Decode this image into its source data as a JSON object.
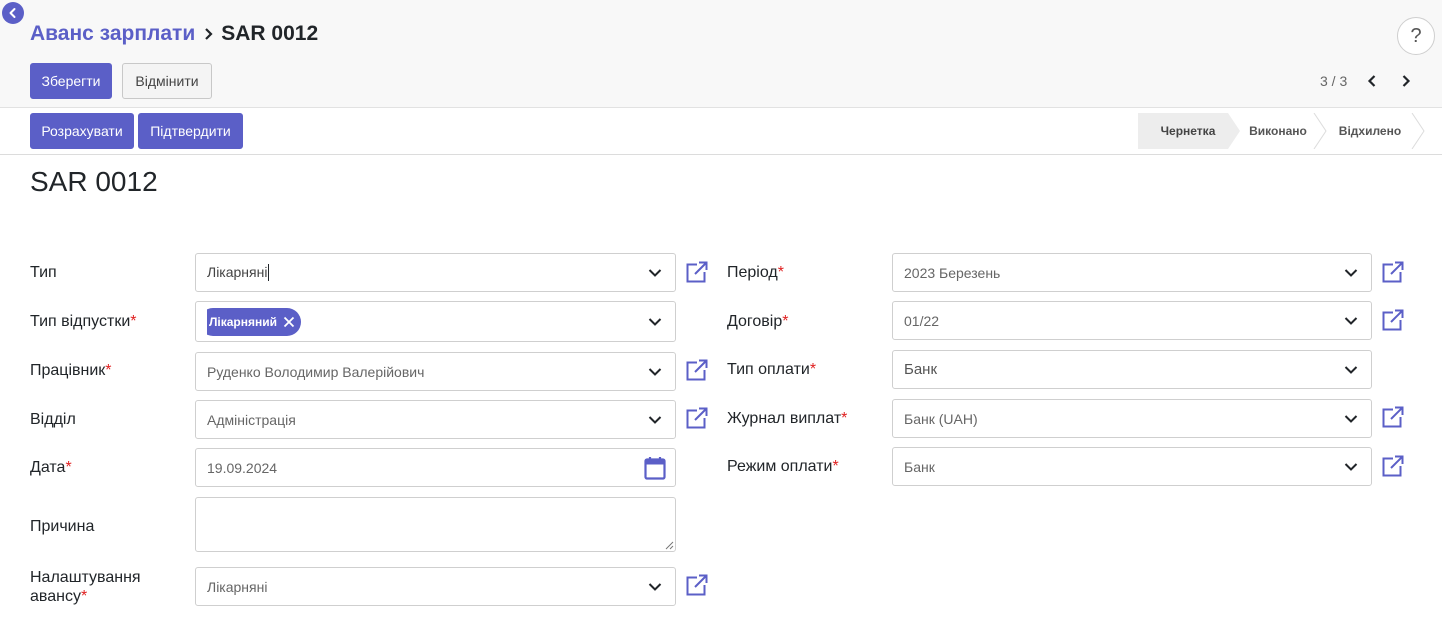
{
  "breadcrumb": {
    "parent": "Аванс зарплати",
    "current": "SAR 0012"
  },
  "toolbar": {
    "save_label": "Зберегти",
    "discard_label": "Відмінити"
  },
  "pager": {
    "text": "3 / 3"
  },
  "actions": {
    "calculate_label": "Розрахувати",
    "confirm_label": "Підтвердити"
  },
  "stages": [
    "Чернетка",
    "Виконано",
    "Відхилено"
  ],
  "record": {
    "title": "SAR 0012"
  },
  "fields": {
    "type": {
      "label": "Тип",
      "value": "Лікарняні"
    },
    "leave_type": {
      "label": "Тип відпустки",
      "tag": "Лікарняний"
    },
    "employee": {
      "label": "Працівник",
      "value": "Руденко Володимир Валерійович"
    },
    "department": {
      "label": "Відділ",
      "value": "Адміністрація"
    },
    "date": {
      "label": "Дата",
      "value": "19.09.2024"
    },
    "reason": {
      "label": "Причина",
      "value": ""
    },
    "advance_settings": {
      "label_line1": "Налаштування",
      "label_line2": "авансу",
      "value": "Лікарняні"
    },
    "period": {
      "label": "Період",
      "value": "2023 Березень"
    },
    "contract": {
      "label": "Договір",
      "value": "01/22"
    },
    "payment_type": {
      "label": "Тип оплати",
      "value": "Банк"
    },
    "payment_journal": {
      "label": "Журнал виплат",
      "value": "Банк (UAH)"
    },
    "payment_mode": {
      "label": "Режим оплати",
      "value": "Банк"
    }
  },
  "colors": {
    "accent": "#5b5fc7",
    "required": "#e02020"
  },
  "icons": [
    "back-arrow-icon",
    "chevron-right-icon",
    "help-icon",
    "chevron-left-icon",
    "chevron-down-icon",
    "external-link-icon",
    "calendar-icon",
    "close-icon"
  ]
}
